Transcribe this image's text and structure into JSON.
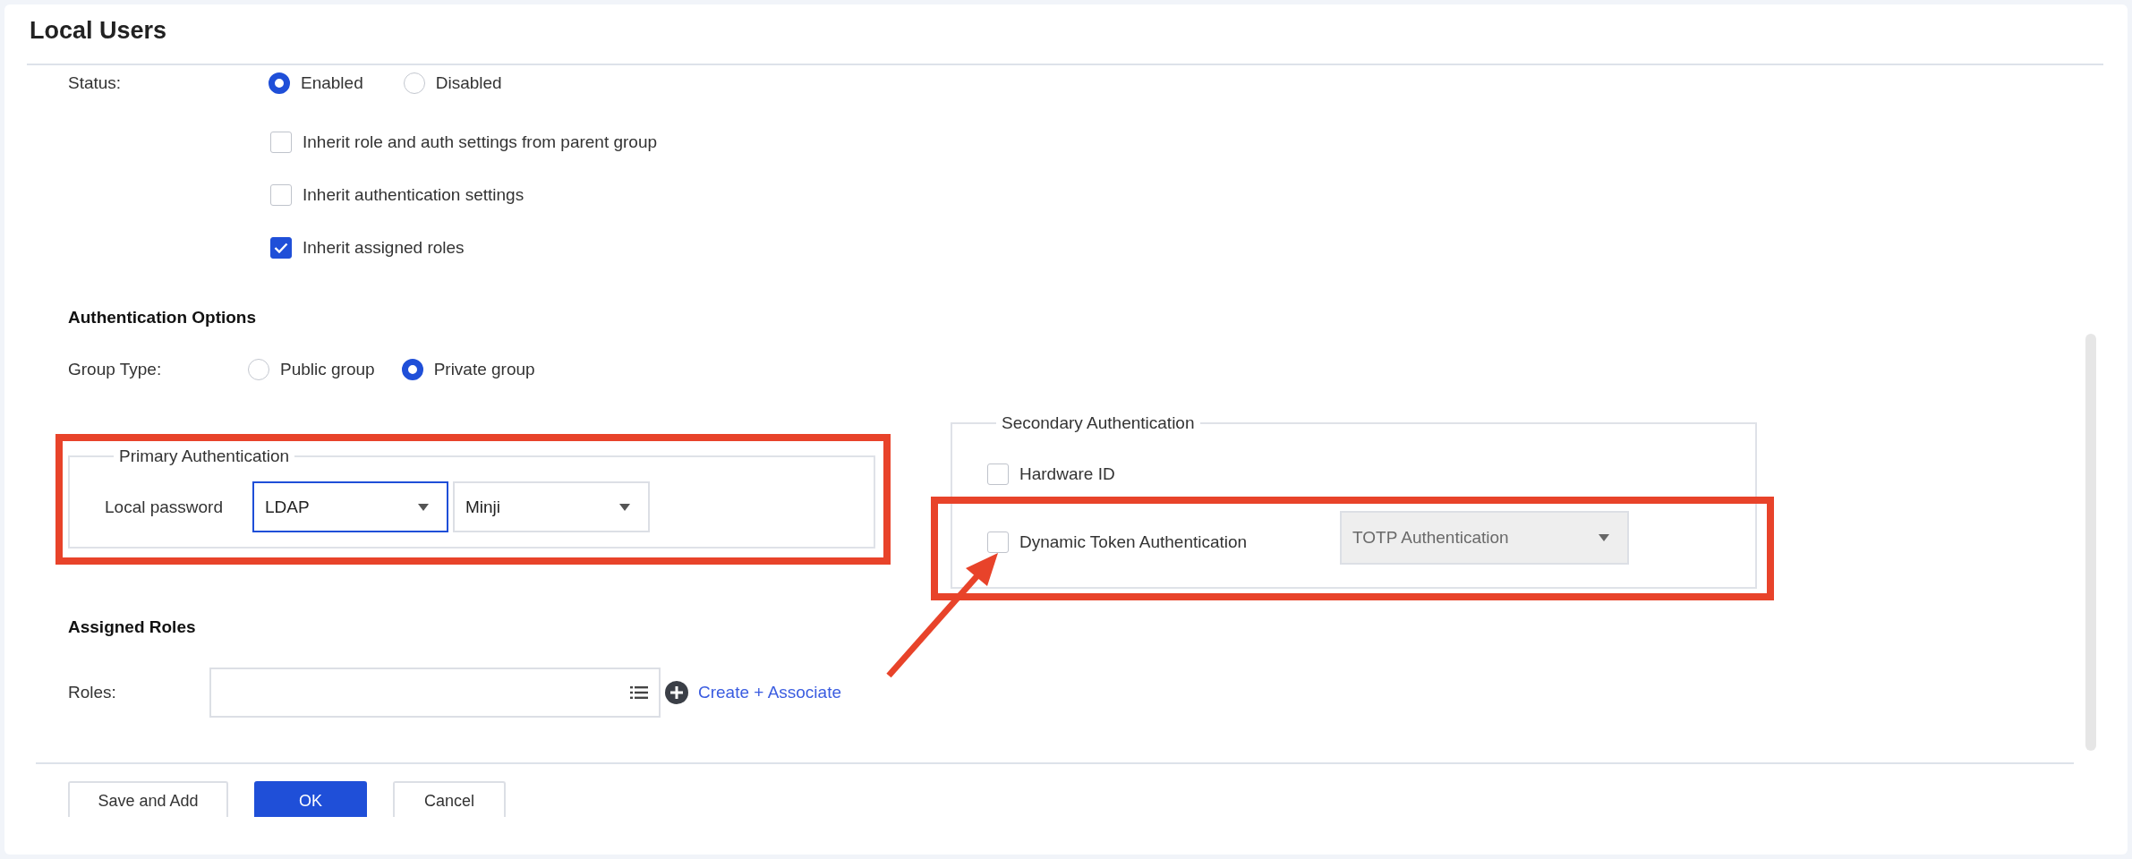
{
  "window": {
    "title": "Local Users"
  },
  "status": {
    "label": "Status:",
    "options": [
      {
        "label": "Enabled",
        "selected": true
      },
      {
        "label": "Disabled",
        "selected": false
      }
    ]
  },
  "inherit_options": [
    {
      "label": "Inherit role and auth settings from parent group",
      "checked": false
    },
    {
      "label": "Inherit authentication settings",
      "checked": false
    },
    {
      "label": "Inherit assigned roles",
      "checked": true
    }
  ],
  "authentication_options": {
    "heading": "Authentication Options",
    "group_type": {
      "label": "Group Type:",
      "options": [
        {
          "label": "Public group",
          "selected": false
        },
        {
          "label": "Private group",
          "selected": true
        }
      ]
    }
  },
  "primary_authentication": {
    "legend": "Primary Authentication",
    "highlighted": true,
    "label": "Local password",
    "selects": [
      {
        "value": "LDAP",
        "focused": true
      },
      {
        "value": "Minji",
        "focused": false
      }
    ]
  },
  "secondary_authentication": {
    "legend": "Secondary Authentication",
    "options": [
      {
        "kind": "checkbox",
        "label": "Hardware ID",
        "checked": false,
        "highlighted": false
      },
      {
        "kind": "checkbox-select",
        "label": "Dynamic Token Authentication",
        "checked": false,
        "highlighted": true,
        "select": {
          "value": "TOTP Authentication",
          "disabled": true
        }
      }
    ]
  },
  "assigned_roles": {
    "heading": "Assigned Roles",
    "label": "Roles:",
    "link": "Create + Associate"
  },
  "buttons": [
    {
      "label": "Save and Add",
      "kind": "default"
    },
    {
      "label": "OK",
      "kind": "primary"
    },
    {
      "label": "Cancel",
      "kind": "default"
    }
  ]
}
